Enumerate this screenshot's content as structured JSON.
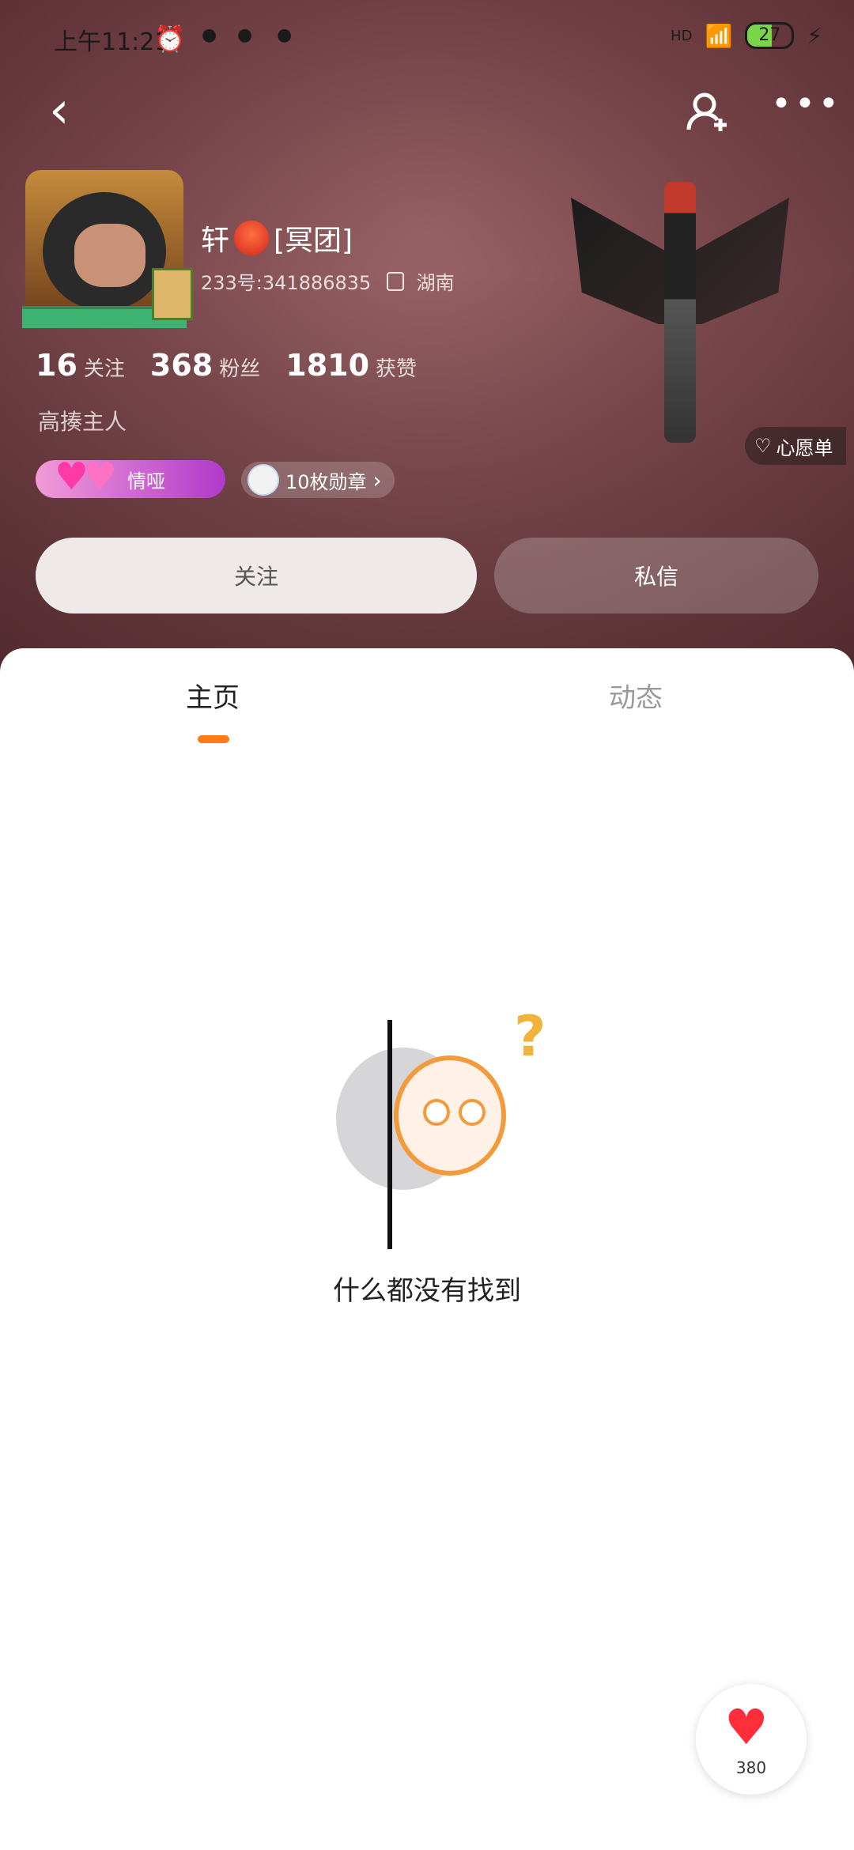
{
  "status_bar": {
    "time": "上午11:21",
    "battery": "27",
    "signal": "HD",
    "icons": [
      "alarm-icon",
      "wifi-icon",
      "battery-icon",
      "charging-icon",
      "signal-icon"
    ]
  },
  "header": {
    "back_icon": "chevron-left-icon",
    "add_friend_icon": "add-friend-icon",
    "more_icon": "more-icon"
  },
  "profile": {
    "name": "轩",
    "name_suffix": "[冥团]",
    "uid": "233号:341886835",
    "location": "湖南",
    "stats": {
      "following": "16",
      "following_label": "关注",
      "fans": "368",
      "fans_label": "粉丝",
      "likes": "1810",
      "likes_label": "获赞"
    },
    "bio": "高揍主人",
    "badge_cp": "情哑",
    "badge_medals": "10枚勋章",
    "wishlist": "心愿单"
  },
  "actions": {
    "follow": "关注",
    "message": "私信"
  },
  "tabs": [
    {
      "label": "主页",
      "active": true
    },
    {
      "label": "动态",
      "active": false
    }
  ],
  "empty_state": {
    "text": "什么都没有找到"
  },
  "fab": {
    "count": "380"
  },
  "colors": {
    "accent": "#ff7a1a",
    "hero_bg": "#7d4a4f",
    "badge_pink": "#b03acb",
    "heart_red": "#ff2e3a"
  }
}
